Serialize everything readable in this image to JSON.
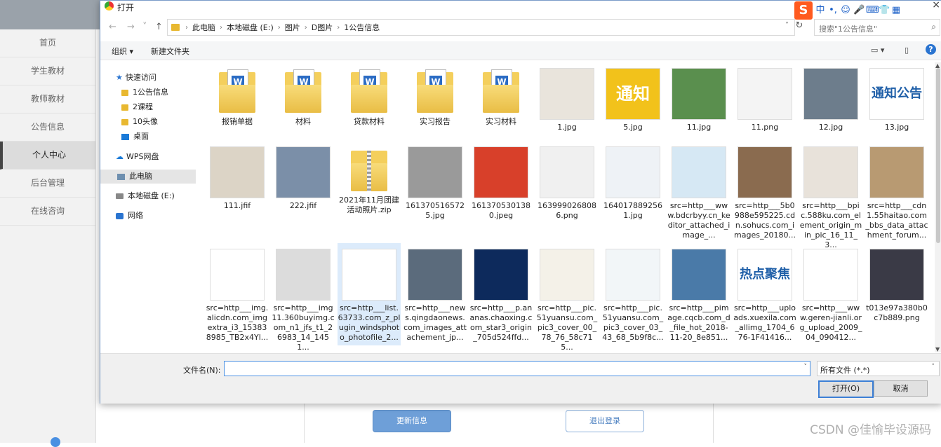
{
  "background": {
    "sidebar": [
      "首页",
      "学生教材",
      "教师教材",
      "公告信息",
      "个人中心",
      "后台管理",
      "在线咨询"
    ],
    "active_index": 4,
    "update_button": "更新信息",
    "logout_button": "退出登录",
    "watermark": "CSDN @佳愉毕设源码"
  },
  "dialog": {
    "title": "打开",
    "ime": {
      "logo": "S",
      "mode": "中",
      "punct": "•,"
    },
    "close": "×",
    "nav": {
      "back": "←",
      "forward": "→",
      "recent": "˅",
      "up": "↑"
    },
    "breadcrumbs": [
      "此电脑",
      "本地磁盘 (E:)",
      "图片",
      "D图片",
      "1公告信息"
    ],
    "search_placeholder": "搜索\"1公告信息\"",
    "toolbar": {
      "organize": "组织 ▾",
      "new_folder": "新建文件夹"
    },
    "nav_pane": [
      {
        "label": "快速访问",
        "icon": "star-icon"
      },
      {
        "label": "1公告信息",
        "icon": "folder-icon"
      },
      {
        "label": "2课程",
        "icon": "folder-icon"
      },
      {
        "label": "10头像",
        "icon": "folder-icon"
      },
      {
        "label": "桌面",
        "icon": "desktop-icon"
      },
      {
        "label": "WPS网盘",
        "icon": "cloud-icon"
      },
      {
        "label": "此电脑",
        "icon": "pc-icon"
      },
      {
        "label": "本地磁盘 (E:)",
        "icon": "drive-icon"
      },
      {
        "label": "网络",
        "icon": "network-icon"
      }
    ],
    "files": [
      {
        "name": "报销单据",
        "kind": "folder"
      },
      {
        "name": "材料",
        "kind": "folder"
      },
      {
        "name": "贷款材料",
        "kind": "folder"
      },
      {
        "name": "实习报告",
        "kind": "folder"
      },
      {
        "name": "实习材料",
        "kind": "folder"
      },
      {
        "name": "1.jpg",
        "kind": "image",
        "color": "#e9e4dc"
      },
      {
        "name": "5.jpg",
        "kind": "image",
        "color": "#f2c21b",
        "text": "通知"
      },
      {
        "name": "11.jpg",
        "kind": "image",
        "color": "#5a8f4e"
      },
      {
        "name": "11.png",
        "kind": "image",
        "color": "#f4f4f4"
      },
      {
        "name": "12.jpg",
        "kind": "image",
        "color": "#6d7d8c"
      },
      {
        "name": "13.jpg",
        "kind": "image",
        "color": "#ffffff",
        "text": "通知公告"
      },
      {
        "name": "111.jfif",
        "kind": "image",
        "color": "#dcd4c6"
      },
      {
        "name": "222.jfif",
        "kind": "image",
        "color": "#7b8fa8"
      },
      {
        "name": "2021年11月团建活动照片.zip",
        "kind": "zip"
      },
      {
        "name": "1613705165725.jpg",
        "kind": "image",
        "color": "#9a9a9a"
      },
      {
        "name": "1613705301380.jpeg",
        "kind": "image",
        "color": "#d8402a"
      },
      {
        "name": "1639990268086.png",
        "kind": "image",
        "color": "#f0f0f0"
      },
      {
        "name": "1640178892561.jpg",
        "kind": "image",
        "color": "#eef2f6"
      },
      {
        "name": "src=http___www.bdcrbyy.cn_keditor_attached_image_...",
        "kind": "image",
        "color": "#d6e8f4"
      },
      {
        "name": "src=http___5b0988e595225.cdn.sohucs.com_images_20180...",
        "kind": "image",
        "color": "#8a6b4f"
      },
      {
        "name": "src=http___bpic.588ku.com_element_origin_min_pic_16_11_3...",
        "kind": "image",
        "color": "#e8e2da"
      },
      {
        "name": "src=http___cdn1.55haitao.com_bbs_data_attachment_forum...",
        "kind": "image",
        "color": "#b89a72"
      },
      {
        "name": "src=http___img.alicdn.com_imgextra_i3_153838985_TB2x4Yl...",
        "kind": "image",
        "color": "#ffffff"
      },
      {
        "name": "src=http___img11.360buyimg.com_n1_jfs_t1_26983_14_1451...",
        "kind": "image",
        "color": "#dcdcdc"
      },
      {
        "name": "src=http___list.63733.com_z_plugin_windsphoto_photofile_2...",
        "kind": "image",
        "color": "#ffffff",
        "selected": true
      },
      {
        "name": "src=http___news.qingdaonews.com_images_attachement_jp...",
        "kind": "image",
        "color": "#5b6b7c"
      },
      {
        "name": "src=http___p.ananas.chaoxing.com_star3_origin_705d524ffd...",
        "kind": "image",
        "color": "#0d2a5c"
      },
      {
        "name": "src=http___pic.51yuansu.com_pic3_cover_00_78_76_58c715...",
        "kind": "image",
        "color": "#f4f1e8"
      },
      {
        "name": "src=http___pic.51yuansu.com_pic3_cover_03_43_68_5b9f8c...",
        "kind": "image",
        "color": "#f2f6f8"
      },
      {
        "name": "src=http___pimage.cqcb.com_d_file_hot_2018-11-20_8e851...",
        "kind": "image",
        "color": "#4a7aa8"
      },
      {
        "name": "src=http___uploads.xuexila.com_allimg_1704_676-1F41416...",
        "kind": "image",
        "color": "#ffffff",
        "text": "热点聚焦"
      },
      {
        "name": "src=http___www.geren-jianli.org_upload_2009_04_090412...",
        "kind": "image",
        "color": "#ffffff"
      },
      {
        "name": "t013e97a380b0c7b889.png",
        "kind": "image",
        "color": "#3a3a46"
      }
    ],
    "filename_label": "文件名(N):",
    "filename_value": "",
    "filetype": "所有文件 (*.*)",
    "open_button": "打开(O)",
    "cancel_button": "取消"
  }
}
